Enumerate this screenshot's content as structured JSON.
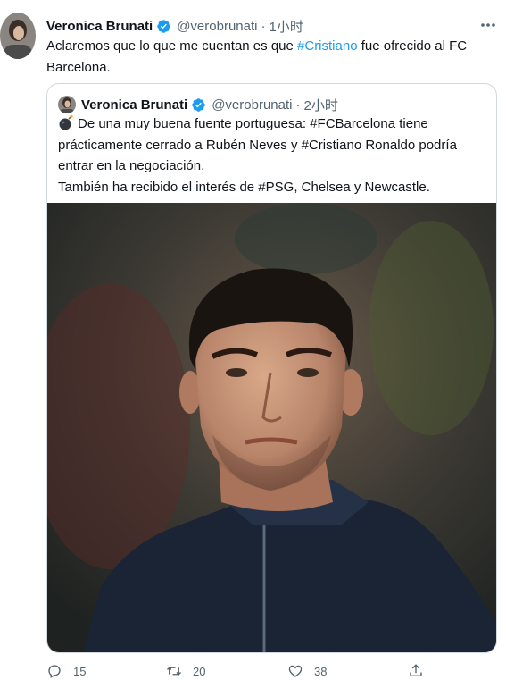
{
  "tweet": {
    "author_name": "Veronica Brunati",
    "handle": "@verobrunati",
    "separator": "·",
    "time": "1小时",
    "text_before": "Aclaremos que lo que me cuentan es que ",
    "hashtag": "#Cristiano",
    "text_after": " fue ofrecido al FC Barcelona."
  },
  "quote": {
    "author_name": "Veronica Brunati",
    "handle": "@verobrunati",
    "separator": "·",
    "time": "2小时",
    "line1": "De una muy buena fuente portuguesa: #FCBarcelona tiene prácticamente cerrado a Rubén Neves y #Cristiano Ronaldo podría entrar en la negociación.",
    "line2": "También ha recibido el interés de #PSG, Chelsea y Newcastle."
  },
  "actions": {
    "replies": "15",
    "retweets": "20",
    "likes": "38"
  },
  "colors": {
    "accent": "#1d9bf0",
    "secondary_text": "#536471",
    "border": "#cfd9de"
  },
  "icons": [
    "verified-badge-icon",
    "more-icon",
    "bomb-emoji-icon",
    "reply-icon",
    "retweet-icon",
    "like-icon",
    "share-icon"
  ]
}
